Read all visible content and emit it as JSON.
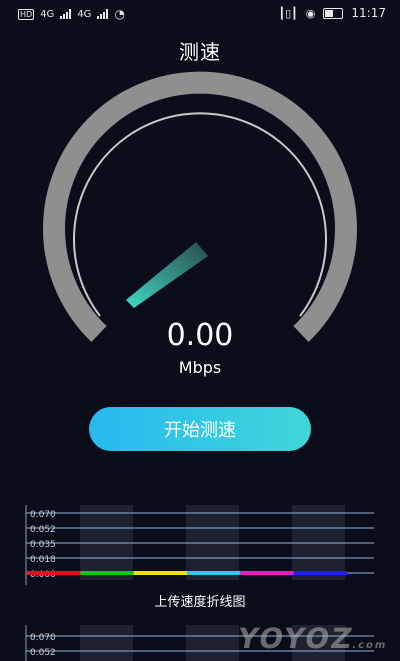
{
  "statusbar": {
    "left_icons": [
      "hd-icon",
      "signal-icon",
      "signal-icon",
      "wifi-icon"
    ],
    "network_1": "4G",
    "network_2": "4G",
    "time": "11:17"
  },
  "header": {
    "title": "测速"
  },
  "gauge": {
    "value": "0.00",
    "unit": "Mbps",
    "needle_color": "#40d2c0",
    "arc_color": "#8f8f8f"
  },
  "start_button": {
    "label": "开始测速"
  },
  "upload_chart": {
    "caption": "上传速度折线图",
    "ticks": [
      "0.070",
      "0.052",
      "0.035",
      "0.018",
      "0.000"
    ],
    "colors": [
      "#e01020",
      "#18c020",
      "#e8e020",
      "#40c0f0",
      "#e020c0",
      "#2020e0"
    ]
  },
  "download_chart": {
    "ticks": [
      "0.070",
      "0.052"
    ]
  },
  "watermark": {
    "text": "YOYOZ",
    "sub": ".com"
  }
}
